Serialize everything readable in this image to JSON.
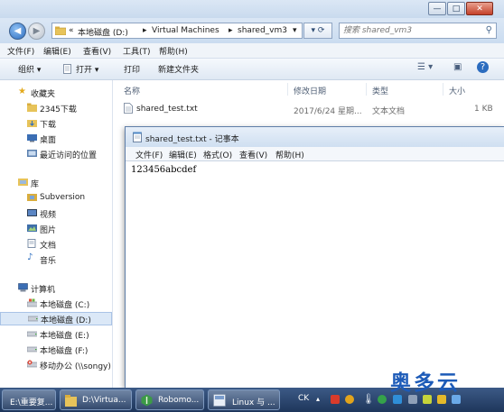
{
  "address": {
    "prefix": "«",
    "crumbs": [
      "本地磁盘 (D:)",
      "Virtual Machines",
      "shared_vm3"
    ],
    "separator": "▸"
  },
  "search": {
    "placeholder": "搜索 shared_vm3"
  },
  "window_controls": {
    "minimize": "—",
    "maximize": "□",
    "close": "✕"
  },
  "menubar": [
    "文件(F)",
    "编辑(E)",
    "查看(V)",
    "工具(T)",
    "帮助(H)"
  ],
  "toolbar": {
    "organize": "组织 ▾",
    "open": "打开 ▾",
    "print": "打印",
    "new_folder": "新建文件夹"
  },
  "navpane": {
    "favorites": {
      "header": "收藏夹",
      "items": [
        "2345下载",
        "下载",
        "桌面",
        "最近访问的位置"
      ]
    },
    "libraries": {
      "header": "库",
      "items": [
        "Subversion",
        "视频",
        "图片",
        "文档",
        "音乐"
      ]
    },
    "computer": {
      "header": "计算机",
      "items": [
        "本地磁盘 (C:)",
        "本地磁盘 (D:)",
        "本地磁盘 (E:)",
        "本地磁盘 (F:)",
        "移动办公 (\\\\songy)"
      ]
    }
  },
  "columns": {
    "name": "名称",
    "date": "修改日期",
    "type": "类型",
    "size": "大小"
  },
  "files": [
    {
      "name": "shared_test.txt",
      "date": "2017/6/24 星期...",
      "type": "文本文档",
      "size": "1 KB"
    }
  ],
  "notepad": {
    "title": "shared_test.txt - 记事本",
    "menu": [
      "文件(F)",
      "编辑(E)",
      "格式(O)",
      "查看(V)",
      "帮助(H)"
    ],
    "content": "123456abcdef"
  },
  "taskbar": {
    "buttons": [
      "E:\\重要复...",
      "D:\\Virtua...",
      "Robomo...",
      "Linux 与 ..."
    ],
    "tray_label": "CK"
  },
  "watermark": "奥多云",
  "colors": {
    "accent": "#2b6cbf",
    "taskbar": "#1e365b",
    "folder": "#e7c35a"
  }
}
